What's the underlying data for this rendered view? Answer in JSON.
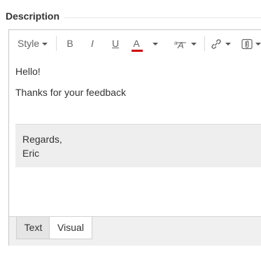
{
  "field": {
    "label": "Description"
  },
  "toolbar": {
    "style_label": "Style",
    "bold_label": "B",
    "italic_label": "I",
    "underline_label": "U",
    "text_color_label": "A",
    "text_color_value": "#cc0000",
    "icons": [
      "caret-down-icon",
      "clear-format-icon",
      "link-icon",
      "attachment-icon"
    ]
  },
  "content": {
    "paragraphs": [
      "Hello!",
      "Thanks for your feedback"
    ],
    "quote_lines": [
      "Regards,",
      "Eric"
    ]
  },
  "tabs": [
    {
      "label": "Text",
      "active": false
    },
    {
      "label": "Visual",
      "active": true
    }
  ]
}
